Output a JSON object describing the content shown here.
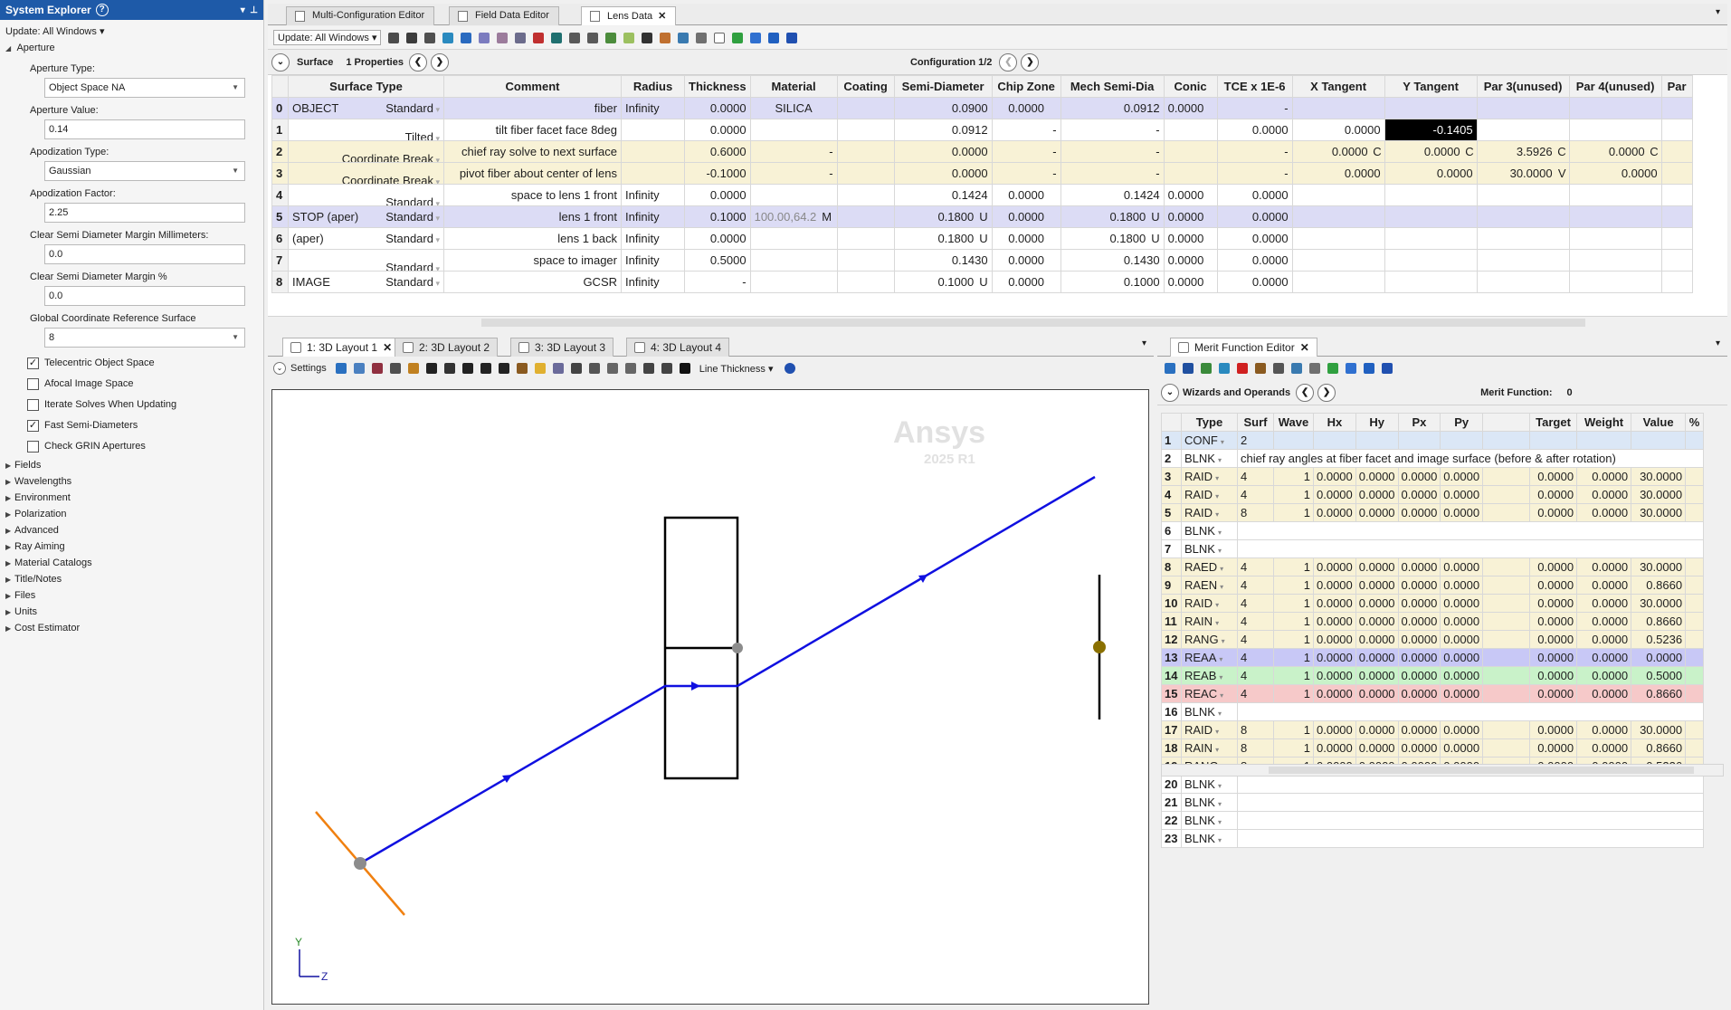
{
  "system_explorer": {
    "title": "System Explorer",
    "update_label": "Update: All Windows",
    "aperture_heading": "Aperture",
    "aperture_type_label": "Aperture Type:",
    "aperture_type_value": "Object Space NA",
    "aperture_value_label": "Aperture Value:",
    "aperture_value": "0.14",
    "apodization_type_label": "Apodization Type:",
    "apodization_type_value": "Gaussian",
    "apodization_factor_label": "Apodization Factor:",
    "apodization_factor_value": "2.25",
    "clear_mm_label": "Clear Semi Diameter Margin Millimeters:",
    "clear_mm_value": "0.0",
    "clear_pct_label": "Clear Semi Diameter Margin %",
    "clear_pct_value": "0.0",
    "gcrs_label": "Global Coordinate Reference Surface",
    "gcrs_value": "8",
    "checks": [
      {
        "label": "Telecentric Object Space",
        "checked": true
      },
      {
        "label": "Afocal Image Space",
        "checked": false
      },
      {
        "label": "Iterate Solves When Updating",
        "checked": false
      },
      {
        "label": "Fast Semi-Diameters",
        "checked": true
      },
      {
        "label": "Check GRIN Apertures",
        "checked": false
      }
    ],
    "sections": [
      "Fields",
      "Wavelengths",
      "Environment",
      "Polarization",
      "Advanced",
      "Ray Aiming",
      "Material Catalogs",
      "Title/Notes",
      "Files",
      "Units",
      "Cost Estimator"
    ]
  },
  "doc_tabs": [
    "Multi-Configuration Editor",
    "Field Data Editor",
    "Lens Data"
  ],
  "lens_toolbar": {
    "update": "Update: All Windows"
  },
  "lens_bar": {
    "surface": "Surface",
    "properties": "1 Properties",
    "configuration": "Configuration 1/2"
  },
  "lens_headers": [
    "",
    "Surface Type",
    "Comment",
    "Radius",
    "Thickness",
    "Material",
    "Coating",
    "Semi-Diameter",
    "Chip Zone",
    "Mech Semi-Dia",
    "Conic",
    "TCE x 1E-6",
    "X Tangent",
    "Y Tangent",
    "Par 3(unused)",
    "Par 4(unused)",
    "Par"
  ],
  "lens_rows": [
    {
      "n": "0",
      "name": "OBJECT",
      "type": "Standard",
      "comment": "fiber",
      "radius": "Infinity",
      "thickness": "0.0000",
      "material": "SILICA",
      "coating": "",
      "semi": "0.0900",
      "chip": "0.0000",
      "mech": "0.0912",
      "conic": "0.0000",
      "tce": "-",
      "p1": "",
      "p1f": "",
      "p2": "",
      "p2f": "",
      "p3": "",
      "p3f": "",
      "p4": "",
      "p4f": "",
      "style": "purple"
    },
    {
      "n": "1",
      "name": "",
      "type": "Tilted",
      "comment": "tilt fiber facet face 8deg",
      "radius": "",
      "thickness": "0.0000",
      "material": "",
      "coating": "",
      "semi": "0.0912",
      "chip": "-",
      "mech": "-",
      "conic": "",
      "tce": "0.0000",
      "p1": "0.0000",
      "p1f": "",
      "p2": "-0.1405",
      "p2f": "",
      "p3": "",
      "p3f": "",
      "p4": "",
      "p4f": "",
      "style": ""
    },
    {
      "n": "2",
      "name": "",
      "type": "Coordinate Break",
      "comment": "chief ray solve to next surface",
      "radius": "",
      "thickness": "0.6000",
      "material": "-",
      "coating": "",
      "semi": "0.0000",
      "chip": "-",
      "mech": "-",
      "conic": "",
      "tce": "-",
      "p1": "0.0000",
      "p1f": "C",
      "p2": "0.0000",
      "p2f": "C",
      "p3": "3.5926",
      "p3f": "C",
      "p4": "0.0000",
      "p4f": "C",
      "style": "yellow"
    },
    {
      "n": "3",
      "name": "",
      "type": "Coordinate Break",
      "comment": "pivot fiber about center of lens",
      "radius": "",
      "thickness": "-0.1000",
      "material": "-",
      "coating": "",
      "semi": "0.0000",
      "chip": "-",
      "mech": "-",
      "conic": "",
      "tce": "-",
      "p1": "0.0000",
      "p1f": "",
      "p2": "0.0000",
      "p2f": "",
      "p3": "30.0000",
      "p3f": "V",
      "p4": "0.0000",
      "p4f": "",
      "style": "yellow"
    },
    {
      "n": "4",
      "name": "",
      "type": "Standard",
      "comment": "space to lens 1 front",
      "radius": "Infinity",
      "thickness": "0.0000",
      "material": "",
      "coating": "",
      "semi": "0.1424",
      "chip": "0.0000",
      "mech": "0.1424",
      "conic": "0.0000",
      "tce": "0.0000",
      "p1": "",
      "p1f": "",
      "p2": "",
      "p2f": "",
      "p3": "",
      "p3f": "",
      "p4": "",
      "p4f": "",
      "style": ""
    },
    {
      "n": "5",
      "name": "STOP (aper)",
      "type": "Standard",
      "comment": "lens 1 front",
      "radius": "Infinity",
      "thickness": "0.1000",
      "material": "100.00,64.2",
      "matf": "M",
      "coating": "",
      "semi": "0.1800",
      "semif": "U",
      "chip": "0.0000",
      "mech": "0.1800",
      "mechf": "U",
      "conic": "0.0000",
      "tce": "0.0000",
      "p1": "",
      "p1f": "",
      "p2": "",
      "p2f": "",
      "p3": "",
      "p3f": "",
      "p4": "",
      "p4f": "",
      "style": "purple"
    },
    {
      "n": "6",
      "name": "(aper)",
      "type": "Standard",
      "comment": "lens 1 back",
      "radius": "Infinity",
      "thickness": "0.0000",
      "material": "",
      "coating": "",
      "semi": "0.1800",
      "semif": "U",
      "chip": "0.0000",
      "mech": "0.1800",
      "mechf": "U",
      "conic": "0.0000",
      "tce": "0.0000",
      "p1": "",
      "p1f": "",
      "p2": "",
      "p2f": "",
      "p3": "",
      "p3f": "",
      "p4": "",
      "p4f": "",
      "style": ""
    },
    {
      "n": "7",
      "name": "",
      "type": "Standard",
      "comment": "space to imager",
      "radius": "Infinity",
      "thickness": "0.5000",
      "material": "",
      "coating": "",
      "semi": "0.1430",
      "chip": "0.0000",
      "mech": "0.1430",
      "conic": "0.0000",
      "tce": "0.0000",
      "p1": "",
      "p1f": "",
      "p2": "",
      "p2f": "",
      "p3": "",
      "p3f": "",
      "p4": "",
      "p4f": "",
      "style": ""
    },
    {
      "n": "8",
      "name": "IMAGE",
      "type": "Standard",
      "comment": "GCSR",
      "radius": "Infinity",
      "thickness": "-",
      "material": "",
      "coating": "",
      "semi": "0.1000",
      "semif": "U",
      "chip": "0.0000",
      "mech": "0.1000",
      "conic": "0.0000",
      "tce": "0.0000",
      "p1": "",
      "p1f": "",
      "p2": "",
      "p2f": "",
      "p3": "",
      "p3f": "",
      "p4": "",
      "p4f": "",
      "style": ""
    }
  ],
  "layout_tabs": [
    "1: 3D Layout 1",
    "2: 3D Layout 2",
    "3: 3D Layout 3",
    "4: 3D Layout 4"
  ],
  "layout_toolbar": {
    "settings": "Settings",
    "line_thickness": "Line Thickness"
  },
  "watermark": {
    "brand": "Ansys",
    "version": "2025 R1"
  },
  "axes": {
    "y": "Y",
    "z": "Z"
  },
  "mfe": {
    "tab": "Merit Function Editor",
    "wizards": "Wizards and Operands",
    "merit_label": "Merit Function:",
    "merit_value": "0",
    "headers": [
      "",
      "Type",
      "Surf",
      "Wave",
      "Hx",
      "Hy",
      "Px",
      "Py",
      "",
      "Target",
      "Weight",
      "Value",
      "%"
    ],
    "rows": [
      {
        "n": "1",
        "type": "CONF",
        "surf": "2",
        "wave": "",
        "hx": "",
        "hy": "",
        "px": "",
        "py": "",
        "target": "",
        "weight": "",
        "value": "",
        "style": "conf"
      },
      {
        "n": "2",
        "type": "BLNK",
        "comment": "chief ray angles at fiber facet and image surface (before & after rotation)",
        "style": "blnk"
      },
      {
        "n": "3",
        "type": "RAID",
        "surf": "4",
        "wave": "1",
        "hx": "0.0000",
        "hy": "0.0000",
        "px": "0.0000",
        "py": "0.0000",
        "target": "0.0000",
        "weight": "0.0000",
        "value": "30.0000",
        "style": "raid"
      },
      {
        "n": "4",
        "type": "RAID",
        "surf": "4",
        "wave": "1",
        "hx": "0.0000",
        "hy": "0.0000",
        "px": "0.0000",
        "py": "0.0000",
        "target": "0.0000",
        "weight": "0.0000",
        "value": "30.0000",
        "style": "raid"
      },
      {
        "n": "5",
        "type": "RAID",
        "surf": "8",
        "wave": "1",
        "hx": "0.0000",
        "hy": "0.0000",
        "px": "0.0000",
        "py": "0.0000",
        "target": "0.0000",
        "weight": "0.0000",
        "value": "30.0000",
        "style": "raid"
      },
      {
        "n": "6",
        "type": "BLNK",
        "style": "blnk"
      },
      {
        "n": "7",
        "type": "BLNK",
        "style": "blnk"
      },
      {
        "n": "8",
        "type": "RAED",
        "surf": "4",
        "wave": "1",
        "hx": "0.0000",
        "hy": "0.0000",
        "px": "0.0000",
        "py": "0.0000",
        "target": "0.0000",
        "weight": "0.0000",
        "value": "30.0000",
        "style": "raid"
      },
      {
        "n": "9",
        "type": "RAEN",
        "surf": "4",
        "wave": "1",
        "hx": "0.0000",
        "hy": "0.0000",
        "px": "0.0000",
        "py": "0.0000",
        "target": "0.0000",
        "weight": "0.0000",
        "value": "0.8660",
        "style": "raid"
      },
      {
        "n": "10",
        "type": "RAID",
        "surf": "4",
        "wave": "1",
        "hx": "0.0000",
        "hy": "0.0000",
        "px": "0.0000",
        "py": "0.0000",
        "target": "0.0000",
        "weight": "0.0000",
        "value": "30.0000",
        "style": "raid"
      },
      {
        "n": "11",
        "type": "RAIN",
        "surf": "4",
        "wave": "1",
        "hx": "0.0000",
        "hy": "0.0000",
        "px": "0.0000",
        "py": "0.0000",
        "target": "0.0000",
        "weight": "0.0000",
        "value": "0.8660",
        "style": "raid"
      },
      {
        "n": "12",
        "type": "RANG",
        "surf": "4",
        "wave": "1",
        "hx": "0.0000",
        "hy": "0.0000",
        "px": "0.0000",
        "py": "0.0000",
        "target": "0.0000",
        "weight": "0.0000",
        "value": "0.5236",
        "style": "raid"
      },
      {
        "n": "13",
        "type": "REAA",
        "surf": "4",
        "wave": "1",
        "hx": "0.0000",
        "hy": "0.0000",
        "px": "0.0000",
        "py": "0.0000",
        "target": "0.0000",
        "weight": "0.0000",
        "value": "0.0000",
        "style": "reaa"
      },
      {
        "n": "14",
        "type": "REAB",
        "surf": "4",
        "wave": "1",
        "hx": "0.0000",
        "hy": "0.0000",
        "px": "0.0000",
        "py": "0.0000",
        "target": "0.0000",
        "weight": "0.0000",
        "value": "0.5000",
        "style": "reab"
      },
      {
        "n": "15",
        "type": "REAC",
        "surf": "4",
        "wave": "1",
        "hx": "0.0000",
        "hy": "0.0000",
        "px": "0.0000",
        "py": "0.0000",
        "target": "0.0000",
        "weight": "0.0000",
        "value": "0.8660",
        "style": "reac"
      },
      {
        "n": "16",
        "type": "BLNK",
        "style": "blnk"
      },
      {
        "n": "17",
        "type": "RAID",
        "surf": "8",
        "wave": "1",
        "hx": "0.0000",
        "hy": "0.0000",
        "px": "0.0000",
        "py": "0.0000",
        "target": "0.0000",
        "weight": "0.0000",
        "value": "30.0000",
        "style": "raid"
      },
      {
        "n": "18",
        "type": "RAIN",
        "surf": "8",
        "wave": "1",
        "hx": "0.0000",
        "hy": "0.0000",
        "px": "0.0000",
        "py": "0.0000",
        "target": "0.0000",
        "weight": "0.0000",
        "value": "0.8660",
        "style": "raid"
      },
      {
        "n": "19",
        "type": "RANG",
        "surf": "8",
        "wave": "1",
        "hx": "0.0000",
        "hy": "0.0000",
        "px": "0.0000",
        "py": "0.0000",
        "target": "0.0000",
        "weight": "0.0000",
        "value": "0.5236",
        "style": "raid"
      },
      {
        "n": "20",
        "type": "BLNK",
        "style": "blnk"
      },
      {
        "n": "21",
        "type": "BLNK",
        "style": "blnk"
      },
      {
        "n": "22",
        "type": "BLNK",
        "style": "blnk"
      },
      {
        "n": "23",
        "type": "BLNK",
        "style": "blnk"
      }
    ]
  },
  "colors": {
    "title_blue": "#1e5aa8",
    "ray_blue": "#1010e0",
    "fiber_orange": "#f08010",
    "selection": "#000000"
  }
}
